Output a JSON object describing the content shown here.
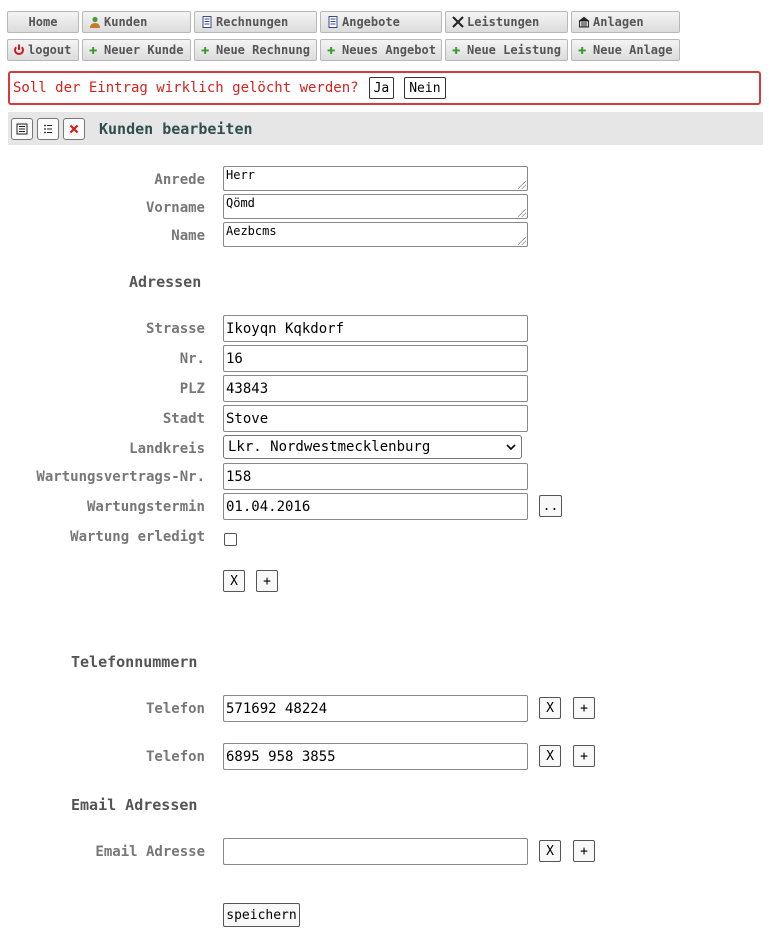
{
  "nav": {
    "row1": [
      {
        "label": "Home",
        "icon": ""
      },
      {
        "label": "Kunden",
        "icon": "user-icon"
      },
      {
        "label": "Rechnungen",
        "icon": "document-icon"
      },
      {
        "label": "Angebote",
        "icon": "document-icon"
      },
      {
        "label": "Leistungen",
        "icon": "tools-icon"
      },
      {
        "label": "Anlagen",
        "icon": "building-icon"
      }
    ],
    "row2": [
      {
        "label": "logout",
        "icon": "power-icon"
      },
      {
        "label": "Neuer Kunde",
        "icon": "plus-icon"
      },
      {
        "label": "Neue Rechnung",
        "icon": "plus-icon"
      },
      {
        "label": "Neues Angebot",
        "icon": "plus-icon"
      },
      {
        "label": "Neue Leistung",
        "icon": "plus-icon"
      },
      {
        "label": "Neue Anlage",
        "icon": "plus-icon"
      }
    ]
  },
  "confirm": {
    "message": "Soll der Eintrag wirklich gelöcht werden?",
    "yes": "Ja",
    "no": "Nein"
  },
  "header": {
    "title": "Kunden bearbeiten"
  },
  "person": {
    "anrede_label": "Anrede",
    "anrede": "Herr",
    "vorname_label": "Vorname",
    "vorname": "Qömd",
    "name_label": "Name",
    "name": "Aezbcms"
  },
  "address": {
    "section": "Adressen",
    "strasse_label": "Strasse",
    "strasse": "Ikoyqn Kqkdorf",
    "nr_label": "Nr.",
    "nr": "16",
    "plz_label": "PLZ",
    "plz": "43843",
    "stadt_label": "Stadt",
    "stadt": "Stove",
    "landkreis_label": "Landkreis",
    "landkreis": "Lkr. Nordwestmecklenburg",
    "vertrag_label": "Wartungsvertrags-Nr.",
    "vertrag": "158",
    "termin_label": "Wartungstermin",
    "termin": "01.04.2016",
    "termin_picker": "..",
    "erledigt_label": "Wartung erledigt",
    "remove": "X",
    "add": "+"
  },
  "phones": {
    "section": "Telefonnummern",
    "items": [
      {
        "label": "Telefon",
        "value": "571692 48224"
      },
      {
        "label": "Telefon",
        "value": "6895 958 3855"
      }
    ],
    "remove": "X",
    "add": "+"
  },
  "emails": {
    "section": "Email Adressen",
    "label": "Email Adresse",
    "value": "",
    "remove": "X",
    "add": "+"
  },
  "save": "speichern"
}
